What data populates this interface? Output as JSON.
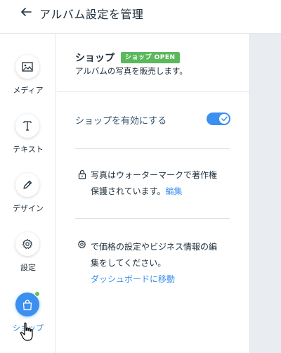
{
  "header": {
    "title": "アルバム設定を管理"
  },
  "sidebar": {
    "items": [
      {
        "label": "メディア",
        "icon": "image-icon"
      },
      {
        "label": "テキスト",
        "icon": "text-icon"
      },
      {
        "label": "デザイン",
        "icon": "pencil-icon"
      },
      {
        "label": "設定",
        "icon": "gear-icon"
      },
      {
        "label": "ショップ",
        "icon": "shopping-bag-icon"
      }
    ],
    "active_index": 4
  },
  "shop": {
    "title": "ショップ",
    "badge": "ショップ OPEN",
    "subtitle": "アルバムの写真を販売します。",
    "toggle_label": "ショップを有効にする",
    "toggle_on": true,
    "watermark_text_1": "写真はウォーターマークで著作権",
    "watermark_text_2": "保護されています。",
    "watermark_link": "編集",
    "settings_text_1": "で価格の設定やビジネス情報の編",
    "settings_text_2": "集をしてください。",
    "settings_link": "ダッシュボードに移動"
  },
  "colors": {
    "accent": "#3b8fef",
    "badge_green": "#5cb85c",
    "notification_dot": "#5cc35a",
    "text_dark": "#20303c"
  }
}
